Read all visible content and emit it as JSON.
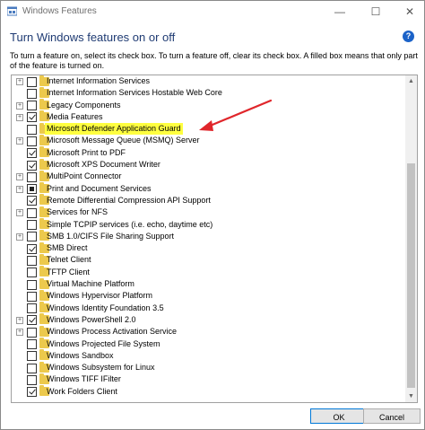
{
  "window": {
    "title": "Windows Features",
    "minimize_glyph": "—",
    "maximize_glyph": "☐",
    "close_glyph": "✕"
  },
  "header": {
    "heading": "Turn Windows features on or off",
    "help_glyph": "?",
    "description": "To turn a feature on, select its check box. To turn a feature off, clear its check box. A filled box means that only part of the feature is turned on."
  },
  "features": [
    {
      "label": "Internet Information Services",
      "state": "unchecked",
      "expandable": true
    },
    {
      "label": "Internet Information Services Hostable Web Core",
      "state": "unchecked",
      "expandable": false
    },
    {
      "label": "Legacy Components",
      "state": "unchecked",
      "expandable": true
    },
    {
      "label": "Media Features",
      "state": "checked",
      "expandable": true
    },
    {
      "label": "Microsoft Defender Application Guard",
      "state": "unchecked",
      "expandable": false,
      "highlighted": true
    },
    {
      "label": "Microsoft Message Queue (MSMQ) Server",
      "state": "unchecked",
      "expandable": true
    },
    {
      "label": "Microsoft Print to PDF",
      "state": "checked",
      "expandable": false
    },
    {
      "label": "Microsoft XPS Document Writer",
      "state": "checked",
      "expandable": false
    },
    {
      "label": "MultiPoint Connector",
      "state": "unchecked",
      "expandable": true
    },
    {
      "label": "Print and Document Services",
      "state": "partial",
      "expandable": true
    },
    {
      "label": "Remote Differential Compression API Support",
      "state": "checked",
      "expandable": false
    },
    {
      "label": "Services for NFS",
      "state": "unchecked",
      "expandable": true
    },
    {
      "label": "Simple TCPIP services (i.e. echo, daytime etc)",
      "state": "unchecked",
      "expandable": false
    },
    {
      "label": "SMB 1.0/CIFS File Sharing Support",
      "state": "unchecked",
      "expandable": true
    },
    {
      "label": "SMB Direct",
      "state": "checked",
      "expandable": false
    },
    {
      "label": "Telnet Client",
      "state": "unchecked",
      "expandable": false
    },
    {
      "label": "TFTP Client",
      "state": "unchecked",
      "expandable": false
    },
    {
      "label": "Virtual Machine Platform",
      "state": "unchecked",
      "expandable": false
    },
    {
      "label": "Windows Hypervisor Platform",
      "state": "unchecked",
      "expandable": false
    },
    {
      "label": "Windows Identity Foundation 3.5",
      "state": "unchecked",
      "expandable": false
    },
    {
      "label": "Windows PowerShell 2.0",
      "state": "checked",
      "expandable": true
    },
    {
      "label": "Windows Process Activation Service",
      "state": "unchecked",
      "expandable": true
    },
    {
      "label": "Windows Projected File System",
      "state": "unchecked",
      "expandable": false
    },
    {
      "label": "Windows Sandbox",
      "state": "unchecked",
      "expandable": false
    },
    {
      "label": "Windows Subsystem for Linux",
      "state": "unchecked",
      "expandable": false
    },
    {
      "label": "Windows TIFF IFilter",
      "state": "unchecked",
      "expandable": false
    },
    {
      "label": "Work Folders Client",
      "state": "checked",
      "expandable": false
    }
  ],
  "footer": {
    "ok_label": "OK",
    "cancel_label": "Cancel"
  },
  "colors": {
    "highlight": "#ffff40",
    "annotation_arrow": "#e0262b",
    "folder": "#ecc94c",
    "help_icon": "#1b62c8",
    "heading": "#1f3b73"
  }
}
